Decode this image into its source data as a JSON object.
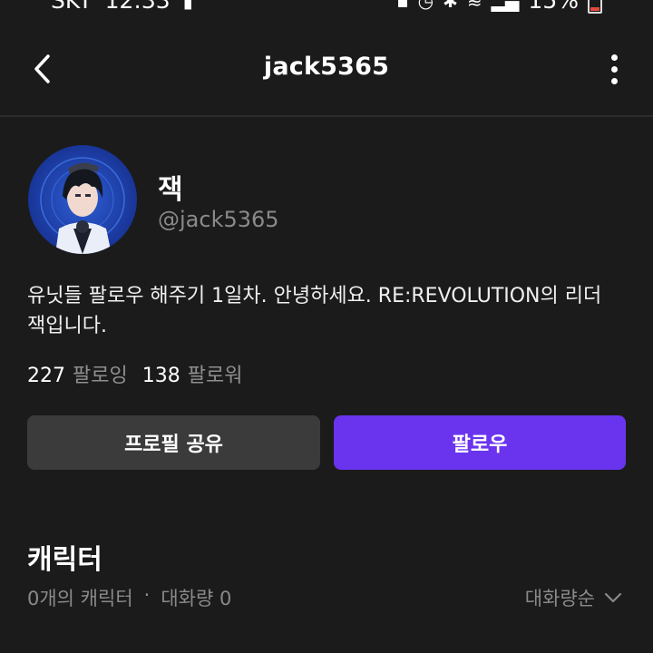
{
  "status_bar": {
    "carrier": "SKT",
    "time": "12:33",
    "battery": "15%"
  },
  "header": {
    "title": "jack5365"
  },
  "profile": {
    "display_name": "잭",
    "handle": "@jack5365",
    "bio": "유닛들 팔로우 해주기 1일차. 안녕하세요. RE:REVOLUTION의 리더 잭입니다.",
    "following_count": "227",
    "following_label": "팔로잉",
    "followers_count": "138",
    "followers_label": "팔로워"
  },
  "actions": {
    "share_label": "프로필 공유",
    "follow_label": "팔로우"
  },
  "characters": {
    "section_title": "캐릭터",
    "count_text": "0개의 캐릭터",
    "separator": "·",
    "chat_volume_text": "대화량 0",
    "sort_label": "대화량순"
  },
  "colors": {
    "background": "#1b1b1b",
    "follow_button": "#6a34ef",
    "share_button": "#3b3b3b",
    "muted_text": "#8a8a8a"
  }
}
